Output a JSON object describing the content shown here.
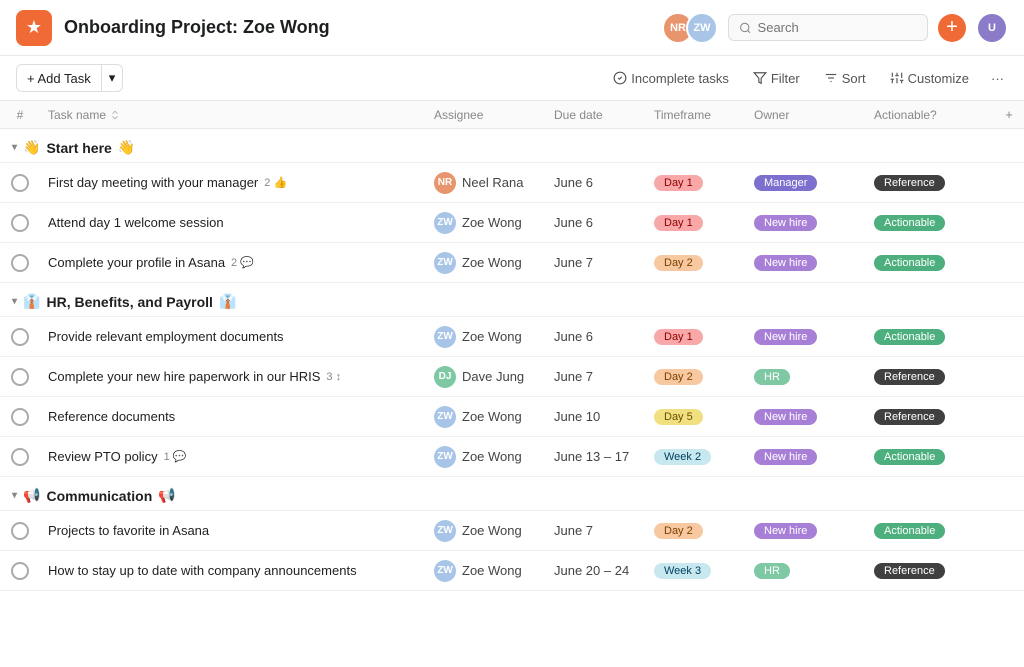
{
  "header": {
    "app_icon": "★",
    "title": "Onboarding Project: Zoe Wong",
    "search_placeholder": "Search",
    "add_button": "+",
    "avatars": [
      {
        "initials": "NR",
        "color": "#e8956d"
      },
      {
        "initials": "ZW",
        "color": "#a8c5e8"
      }
    ],
    "user_avatar": {
      "initials": "U",
      "color": "#8b7bc8"
    }
  },
  "toolbar": {
    "add_task_label": "+ Add Task",
    "dropdown_arrow": "▾",
    "incomplete_tasks": "Incomplete tasks",
    "filter": "Filter",
    "sort": "Sort",
    "customize": "Customize",
    "more": "···"
  },
  "table": {
    "columns": [
      "#",
      "Task name",
      "",
      "Assignee",
      "Due date",
      "Timeframe",
      "Owner",
      "Actionable?",
      "+"
    ]
  },
  "sections": [
    {
      "id": "start-here",
      "emoji": "👋",
      "title": "Start here",
      "tasks": [
        {
          "name": "First day meeting with your manager",
          "badge_count": "2",
          "badge_icon": "👍",
          "assignee": "Neel Rana",
          "assignee_color": "#e8956d",
          "due": "June 6",
          "timeframe": "Day 1",
          "timeframe_class": "tag-day1",
          "owner": "Manager",
          "owner_class": "tag-manager",
          "actionable": "Reference",
          "actionable_class": "tag-reference"
        },
        {
          "name": "Attend day 1 welcome session",
          "badge_count": "",
          "badge_icon": "",
          "assignee": "Zoe Wong",
          "assignee_color": "#a8c5e8",
          "due": "June 6",
          "timeframe": "Day 1",
          "timeframe_class": "tag-day1",
          "owner": "New hire",
          "owner_class": "tag-newhire",
          "actionable": "Actionable",
          "actionable_class": "tag-actionable"
        },
        {
          "name": "Complete your profile in Asana",
          "badge_count": "2",
          "badge_icon": "💬",
          "assignee": "Zoe Wong",
          "assignee_color": "#a8c5e8",
          "due": "June 7",
          "timeframe": "Day 2",
          "timeframe_class": "tag-day2",
          "owner": "New hire",
          "owner_class": "tag-newhire",
          "actionable": "Actionable",
          "actionable_class": "tag-actionable"
        }
      ]
    },
    {
      "id": "hr-benefits",
      "emoji": "👔",
      "title": "HR, Benefits, and Payroll",
      "tasks": [
        {
          "name": "Provide relevant employment documents",
          "badge_count": "",
          "badge_icon": "",
          "assignee": "Zoe Wong",
          "assignee_color": "#a8c5e8",
          "due": "June 6",
          "timeframe": "Day 1",
          "timeframe_class": "tag-day1",
          "owner": "New hire",
          "owner_class": "tag-newhire",
          "actionable": "Actionable",
          "actionable_class": "tag-actionable"
        },
        {
          "name": "Complete your new hire paperwork in our HRIS",
          "badge_count": "3",
          "badge_icon": "↕",
          "assignee": "Dave Jung",
          "assignee_color": "#7ec8a4",
          "due": "June 7",
          "timeframe": "Day 2",
          "timeframe_class": "tag-day2",
          "owner": "HR",
          "owner_class": "tag-hr",
          "actionable": "Reference",
          "actionable_class": "tag-reference"
        },
        {
          "name": "Reference documents",
          "badge_count": "",
          "badge_icon": "",
          "assignee": "Zoe Wong",
          "assignee_color": "#a8c5e8",
          "due": "June 10",
          "timeframe": "Day 5",
          "timeframe_class": "tag-day5",
          "owner": "New hire",
          "owner_class": "tag-newhire",
          "actionable": "Reference",
          "actionable_class": "tag-reference"
        },
        {
          "name": "Review PTO policy",
          "badge_count": "1",
          "badge_icon": "💬",
          "assignee": "Zoe Wong",
          "assignee_color": "#a8c5e8",
          "due": "June 13 – 17",
          "timeframe": "Week 2",
          "timeframe_class": "tag-week2",
          "owner": "New hire",
          "owner_class": "tag-newhire",
          "actionable": "Actionable",
          "actionable_class": "tag-actionable"
        }
      ]
    },
    {
      "id": "communication",
      "emoji": "📢",
      "title": "Communication",
      "tasks": [
        {
          "name": "Projects to favorite in Asana",
          "badge_count": "",
          "badge_icon": "",
          "assignee": "Zoe Wong",
          "assignee_color": "#a8c5e8",
          "due": "June 7",
          "timeframe": "Day 2",
          "timeframe_class": "tag-day2",
          "owner": "New hire",
          "owner_class": "tag-newhire",
          "actionable": "Actionable",
          "actionable_class": "tag-actionable"
        },
        {
          "name": "How to stay up to date with company announcements",
          "badge_count": "",
          "badge_icon": "",
          "assignee": "Zoe Wong",
          "assignee_color": "#a8c5e8",
          "due": "June 20 – 24",
          "timeframe": "Week 3",
          "timeframe_class": "tag-week3",
          "owner": "HR",
          "owner_class": "tag-hr",
          "actionable": "Reference",
          "actionable_class": "tag-reference"
        }
      ]
    }
  ]
}
